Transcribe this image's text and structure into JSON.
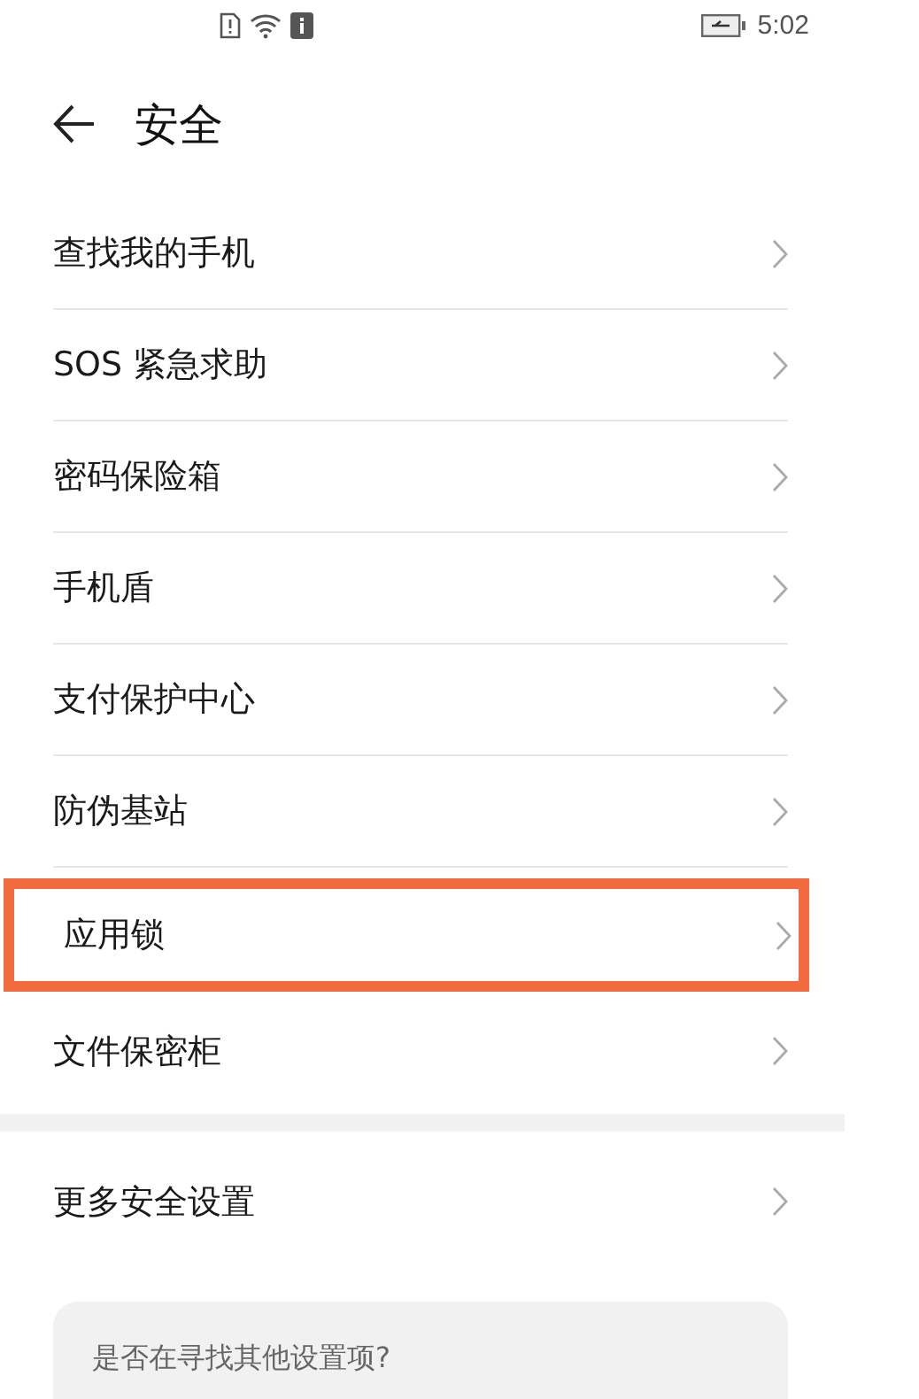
{
  "status_bar": {
    "time": "5:02"
  },
  "header": {
    "title": "安全"
  },
  "groups": [
    {
      "items": [
        {
          "label": "查找我的手机",
          "highlighted": false
        },
        {
          "label": "SOS 紧急求助",
          "highlighted": false
        },
        {
          "label": "密码保险箱",
          "highlighted": false
        },
        {
          "label": "手机盾",
          "highlighted": false
        },
        {
          "label": "支付保护中心",
          "highlighted": false
        },
        {
          "label": "防伪基站",
          "highlighted": false
        },
        {
          "label": "应用锁",
          "highlighted": true
        },
        {
          "label": "文件保密柜",
          "highlighted": false
        }
      ]
    },
    {
      "items": [
        {
          "label": "更多安全设置",
          "highlighted": false
        }
      ]
    }
  ],
  "suggestion_card": {
    "question": "是否在寻找其他设置项?"
  }
}
